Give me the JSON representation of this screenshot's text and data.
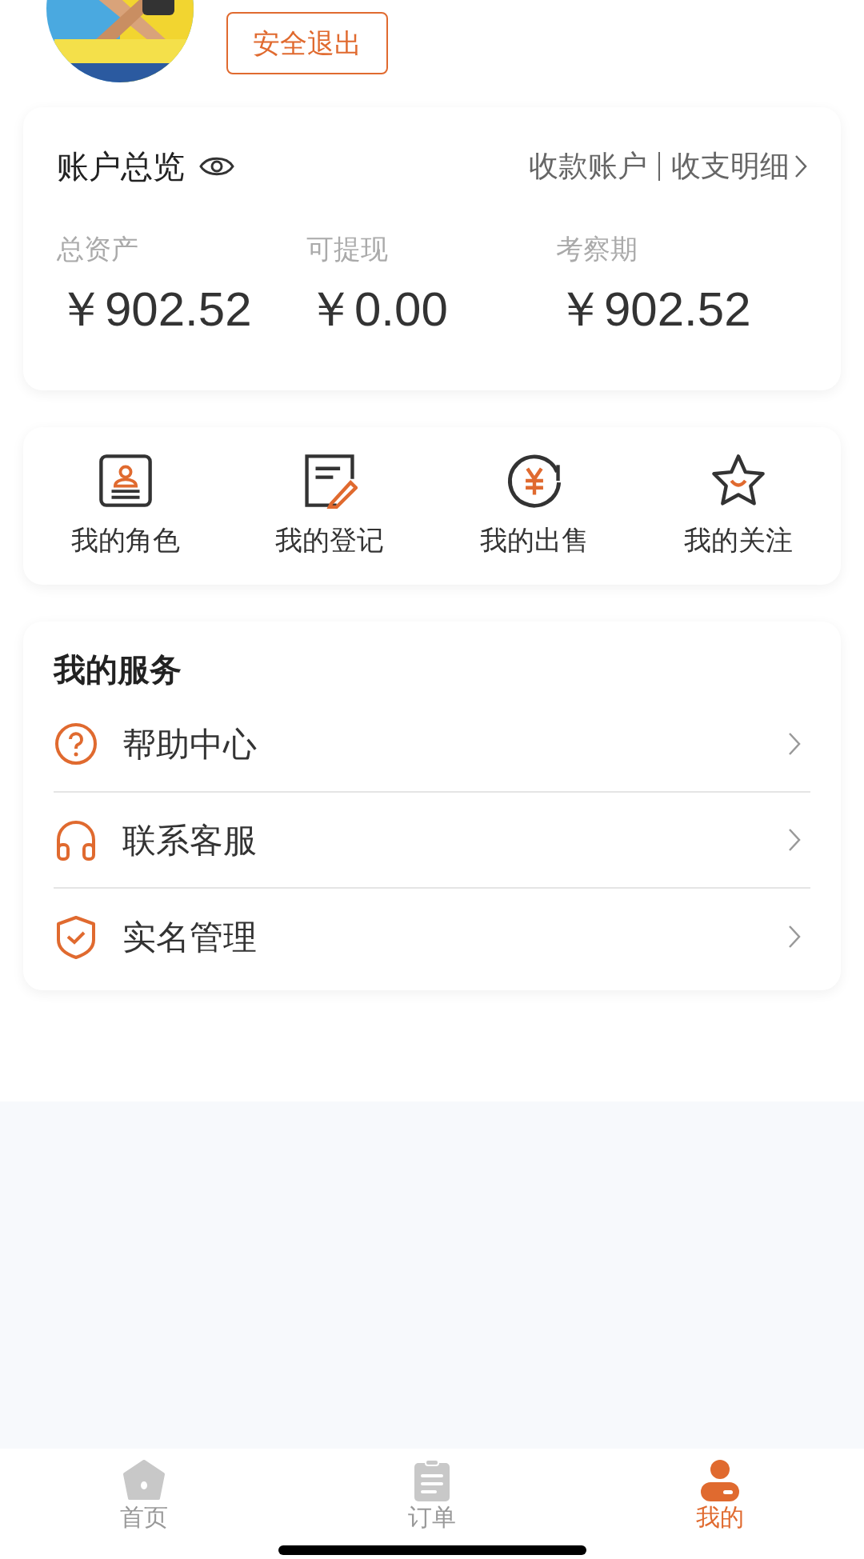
{
  "profile": {
    "logout_button": "安全退出"
  },
  "account": {
    "title": "账户总览",
    "links": [
      "收款账户",
      "收支明细"
    ],
    "stats": [
      {
        "label": "总资产",
        "value": "￥902.52"
      },
      {
        "label": "可提现",
        "value": "￥0.00"
      },
      {
        "label": "考察期",
        "value": "￥902.52"
      }
    ]
  },
  "shortcuts": [
    {
      "kind": "role",
      "label": "我的角色"
    },
    {
      "kind": "register",
      "label": "我的登记"
    },
    {
      "kind": "sale",
      "label": "我的出售"
    },
    {
      "kind": "follow",
      "label": "我的关注"
    }
  ],
  "services": {
    "title": "我的服务",
    "items": [
      {
        "kind": "help",
        "label": "帮助中心"
      },
      {
        "kind": "support",
        "label": "联系客服"
      },
      {
        "kind": "verify",
        "label": "实名管理"
      }
    ]
  },
  "tab_bar": [
    {
      "kind": "home",
      "label": "首页",
      "selected": false
    },
    {
      "kind": "orders",
      "label": "订单",
      "selected": false
    },
    {
      "kind": "me",
      "label": "我的",
      "selected": true
    }
  ]
}
